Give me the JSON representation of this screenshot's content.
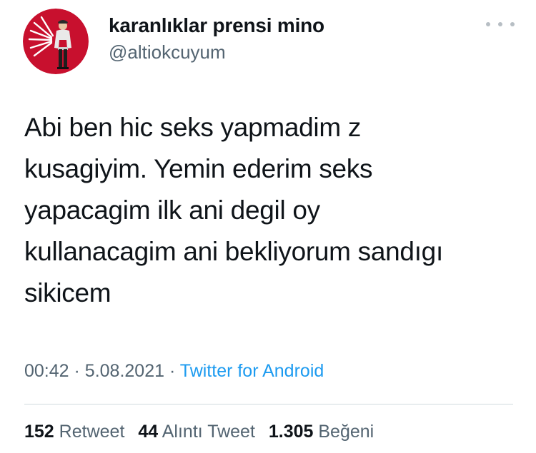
{
  "user": {
    "display_name": "karanlıklar prensi mino",
    "handle": "@altiokcuyum",
    "avatar_bg": "#c8102e"
  },
  "icons": {
    "more": "more-options-icon"
  },
  "tweet": {
    "lines": [
      "Abi ben hic seks yapmadim z",
      "kusagiyim. Yemin ederim seks",
      "yapacagim ilk ani degil oy",
      "kullanacagim ani bekliyorum sandıgı",
      "sikicem"
    ],
    "time": "00:42",
    "separator": "·",
    "date": "5.08.2021",
    "source": "Twitter for Android"
  },
  "stats": {
    "retweets_count": "152",
    "retweets_label": "Retweet",
    "quotes_count": "44",
    "quotes_label": "Alıntı Tweet",
    "likes_count": "1.305",
    "likes_label": "Beğeni"
  },
  "colors": {
    "link": "#1d9bf0",
    "secondary_text": "#536471",
    "primary_text": "#0f1419"
  }
}
